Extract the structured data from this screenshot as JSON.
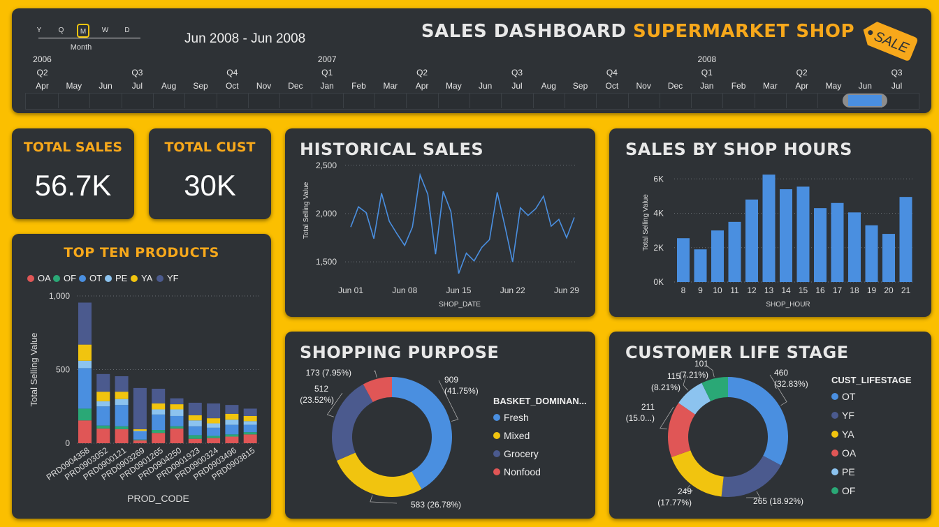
{
  "header": {
    "title_main": "SALES DASHBOARD ",
    "title_accent": "SUPERMARKET SHOP",
    "sale_tag": "SALE",
    "date_range": "Jun 2008 - Jun 2008",
    "granularity": {
      "options": [
        "Y",
        "Q",
        "M",
        "W",
        "D"
      ],
      "selected": "M",
      "label": "Month"
    },
    "timeline": {
      "years": [
        {
          "label": "2006",
          "index": 0
        },
        {
          "label": "2007",
          "index": 9
        },
        {
          "label": "2008",
          "index": 21
        }
      ],
      "quarters": [
        {
          "label": "Q2",
          "index": 0
        },
        {
          "label": "Q3",
          "index": 3
        },
        {
          "label": "Q4",
          "index": 6
        },
        {
          "label": "Q1",
          "index": 9
        },
        {
          "label": "Q2",
          "index": 12
        },
        {
          "label": "Q3",
          "index": 15
        },
        {
          "label": "Q4",
          "index": 18
        },
        {
          "label": "Q1",
          "index": 21
        },
        {
          "label": "Q2",
          "index": 24
        },
        {
          "label": "Q3",
          "index": 27
        }
      ],
      "months": [
        "Apr",
        "May",
        "Jun",
        "Jul",
        "Aug",
        "Sep",
        "Oct",
        "Nov",
        "Dec",
        "Jan",
        "Feb",
        "Mar",
        "Apr",
        "May",
        "Jun",
        "Jul",
        "Aug",
        "Sep",
        "Oct",
        "Nov",
        "Dec",
        "Jan",
        "Feb",
        "Mar",
        "Apr",
        "May",
        "Jun",
        "Jul"
      ],
      "selected_index": 26
    }
  },
  "kpis": {
    "total_sales": {
      "title": "TOTAL SALES",
      "value": "56.7K"
    },
    "total_cust": {
      "title": "TOTAL CUST",
      "value": "30K"
    }
  },
  "panels": {
    "top_products": "TOP TEN PRODUCTS",
    "historical": "HISTORICAL SALES",
    "shop_hours": "SALES BY SHOP HOURS",
    "purpose": "SHOPPING PURPOSE",
    "lifestage": "CUSTOMER LIFE STAGE"
  },
  "colors": {
    "blue": "#4a8fe0",
    "navy": "#4b5a8e",
    "yellow": "#f1c40f",
    "red": "#e05656",
    "lightblue": "#8cc3ef",
    "green": "#2aa876",
    "orange": "#f7a81b",
    "panel": "#2e3236"
  },
  "chart_data": [
    {
      "id": "top_products",
      "type": "bar",
      "stacked": true,
      "xlabel": "PROD_CODE",
      "ylabel": "Total Selling Value",
      "ylim": [
        0,
        1000
      ],
      "yticks": [
        {
          "v": 0,
          "label": "0"
        },
        {
          "v": 500,
          "label": "500"
        },
        {
          "v": 1000,
          "label": "1,000"
        }
      ],
      "legend": [
        "OA",
        "OF",
        "OT",
        "PE",
        "YA",
        "YF"
      ],
      "categories": [
        "PRD0904358",
        "PRD0903052",
        "PRD0900121",
        "PRD0903269",
        "PRD0901265",
        "PRD0904250",
        "PRD0901923",
        "PRD0900324",
        "PRD0903496",
        "PRD0903815"
      ],
      "series": [
        {
          "name": "OA",
          "color": "#e05656",
          "values": [
            155,
            100,
            95,
            20,
            70,
            100,
            30,
            35,
            45,
            60
          ]
        },
        {
          "name": "OF",
          "color": "#2aa876",
          "values": [
            80,
            20,
            20,
            5,
            20,
            15,
            25,
            15,
            15,
            15
          ]
        },
        {
          "name": "OT",
          "color": "#4a8fe0",
          "values": [
            275,
            130,
            145,
            55,
            105,
            70,
            60,
            55,
            65,
            50
          ]
        },
        {
          "name": "PE",
          "color": "#8cc3ef",
          "values": [
            50,
            35,
            40,
            5,
            35,
            45,
            40,
            30,
            35,
            25
          ]
        },
        {
          "name": "YA",
          "color": "#f1c40f",
          "values": [
            110,
            65,
            50,
            10,
            40,
            35,
            35,
            35,
            40,
            35
          ]
        },
        {
          "name": "YF",
          "color": "#4b5a8e",
          "values": [
            285,
            120,
            105,
            280,
            100,
            40,
            85,
            100,
            60,
            50
          ]
        }
      ]
    },
    {
      "id": "historical",
      "type": "line",
      "xlabel": "SHOP_DATE",
      "ylabel": "Total Selling Value",
      "ylim": [
        1400,
        2520
      ],
      "yticks": [
        {
          "v": 1500,
          "label": "1,500"
        },
        {
          "v": 2000,
          "label": "2,000"
        },
        {
          "v": 2500,
          "label": "2,500"
        }
      ],
      "xticks": [
        {
          "day": 1,
          "label": "Jun 01"
        },
        {
          "day": 8,
          "label": "Jun 08"
        },
        {
          "day": 15,
          "label": "Jun 15"
        },
        {
          "day": 22,
          "label": "Jun 22"
        },
        {
          "day": 29,
          "label": "Jun 29"
        }
      ],
      "x": [
        1,
        2,
        3,
        4,
        5,
        6,
        7,
        8,
        9,
        10,
        11,
        12,
        13,
        14,
        15,
        16,
        17,
        18,
        19,
        20,
        21,
        22,
        23,
        24,
        25,
        26,
        27,
        28,
        29,
        30
      ],
      "values": [
        1860,
        2070,
        2010,
        1740,
        2210,
        1920,
        1790,
        1670,
        1860,
        2400,
        2200,
        1580,
        2230,
        2020,
        1380,
        1590,
        1510,
        1650,
        1730,
        2220,
        1870,
        1500,
        2060,
        1980,
        2050,
        2180,
        1870,
        1940,
        1750,
        1960
      ]
    },
    {
      "id": "shop_hours",
      "type": "bar",
      "xlabel": "SHOP_HOUR",
      "ylabel": "Total Selling Value",
      "ylim": [
        0,
        6500
      ],
      "yticks": [
        {
          "v": 0,
          "label": "0K"
        },
        {
          "v": 2000,
          "label": "2K"
        },
        {
          "v": 4000,
          "label": "4K"
        },
        {
          "v": 6000,
          "label": "6K"
        }
      ],
      "categories": [
        "8",
        "9",
        "10",
        "11",
        "12",
        "13",
        "14",
        "15",
        "16",
        "17",
        "18",
        "19",
        "20",
        "21"
      ],
      "values": [
        2550,
        1900,
        3000,
        3500,
        4800,
        6250,
        5400,
        5550,
        4300,
        4600,
        4050,
        3300,
        2800,
        4950
      ]
    },
    {
      "id": "purpose",
      "type": "pie",
      "donut": true,
      "legend_title": "BASKET_DOMINAN...",
      "slices": [
        {
          "name": "Fresh",
          "value": 909,
          "label": "909",
          "pct": "(41.75%)",
          "color": "#4a8fe0"
        },
        {
          "name": "Mixed",
          "value": 583,
          "label": "583 (26.78%)",
          "pct": "",
          "color": "#f1c40f"
        },
        {
          "name": "Grocery",
          "value": 512,
          "label": "512",
          "pct": "(23.52%)",
          "color": "#4b5a8e"
        },
        {
          "name": "Nonfood",
          "value": 173,
          "label": "173 (7.95%)",
          "pct": "",
          "color": "#e05656"
        }
      ]
    },
    {
      "id": "lifestage",
      "type": "pie",
      "donut": true,
      "legend_title": "CUST_LIFESTAGE",
      "slices": [
        {
          "name": "OT",
          "value": 460,
          "label": "460",
          "pct": "(32.83%)",
          "color": "#4a8fe0"
        },
        {
          "name": "YF",
          "value": 265,
          "label": "265 (18.92%)",
          "pct": "",
          "color": "#4b5a8e"
        },
        {
          "name": "YA",
          "value": 249,
          "label": "249",
          "pct": "(17.77%)",
          "color": "#f1c40f"
        },
        {
          "name": "OA",
          "value": 211,
          "label": "211",
          "pct": "(15.0...)",
          "color": "#e05656"
        },
        {
          "name": "PE",
          "value": 115,
          "label": "115",
          "pct": "(8.21%)",
          "color": "#8cc3ef"
        },
        {
          "name": "OF",
          "value": 101,
          "label": "101",
          "pct": "(7.21%)",
          "color": "#2aa876"
        }
      ]
    }
  ]
}
